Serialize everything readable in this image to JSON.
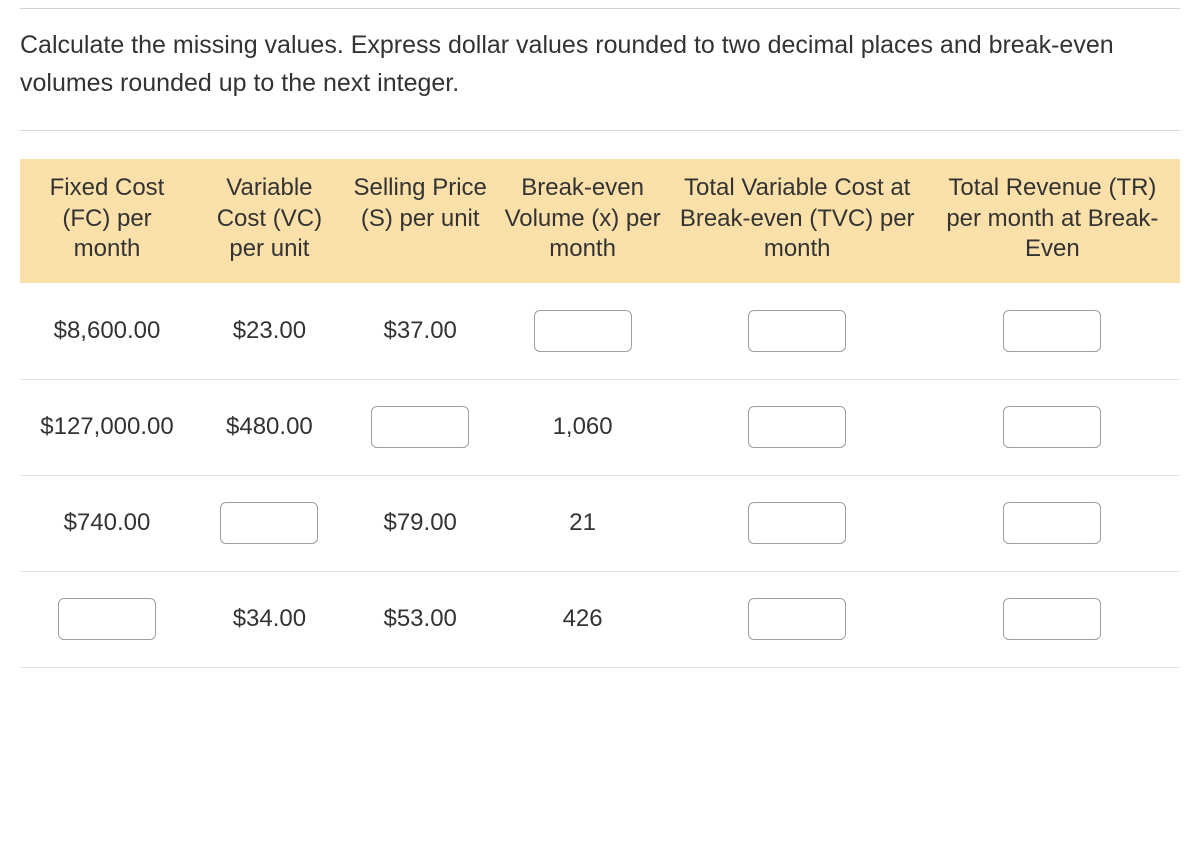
{
  "instructions": "Calculate the missing values. Express dollar values rounded to two decimal places and break-even volumes rounded up to the next integer.",
  "headers": {
    "fc": "Fixed Cost (FC) per month",
    "vc": "Variable Cost (VC) per unit",
    "s": "Selling Price (S) per unit",
    "x": "Break-even Volume (x) per month",
    "tvc": "Total Variable Cost at Break-even (TVC) per month",
    "tr": "Total Revenue (TR) per month at Break-Even"
  },
  "rows": [
    {
      "fc": {
        "type": "text",
        "value": "$8,600.00"
      },
      "vc": {
        "type": "text",
        "value": "$23.00"
      },
      "s": {
        "type": "text",
        "value": "$37.00"
      },
      "x": {
        "type": "input",
        "value": ""
      },
      "tvc": {
        "type": "input",
        "value": ""
      },
      "tr": {
        "type": "input",
        "value": ""
      }
    },
    {
      "fc": {
        "type": "text",
        "value": "$127,000.00"
      },
      "vc": {
        "type": "text",
        "value": "$480.00"
      },
      "s": {
        "type": "input",
        "value": ""
      },
      "x": {
        "type": "text",
        "value": "1,060"
      },
      "tvc": {
        "type": "input",
        "value": ""
      },
      "tr": {
        "type": "input",
        "value": ""
      }
    },
    {
      "fc": {
        "type": "text",
        "value": "$740.00"
      },
      "vc": {
        "type": "input",
        "value": ""
      },
      "s": {
        "type": "text",
        "value": "$79.00"
      },
      "x": {
        "type": "text",
        "value": "21"
      },
      "tvc": {
        "type": "input",
        "value": ""
      },
      "tr": {
        "type": "input",
        "value": ""
      }
    },
    {
      "fc": {
        "type": "input",
        "value": ""
      },
      "vc": {
        "type": "text",
        "value": "$34.00"
      },
      "s": {
        "type": "text",
        "value": "$53.00"
      },
      "x": {
        "type": "text",
        "value": "426"
      },
      "tvc": {
        "type": "input",
        "value": ""
      },
      "tr": {
        "type": "input",
        "value": ""
      }
    }
  ]
}
